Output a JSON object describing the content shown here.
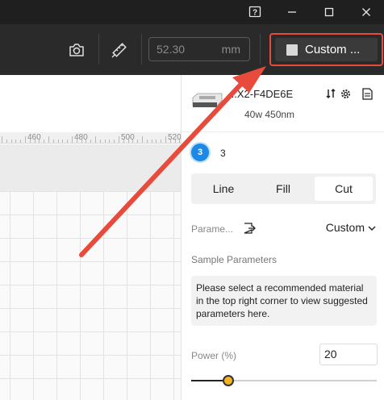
{
  "titlebar": {
    "help_icon": "help-icon",
    "minimize_icon": "minimize-icon",
    "maximize_icon": "maximize-icon",
    "close_icon": "close-icon"
  },
  "toolbar": {
    "camera_icon": "camera-icon",
    "measure_icon": "measure-icon",
    "zoom_value": "52.30",
    "zoom_unit": "mm",
    "custom_label": "Custom ..."
  },
  "ruler": {
    "labels": [
      "460",
      "480",
      "500",
      "520"
    ]
  },
  "device": {
    "name": "...X2-F4DE6E",
    "spec": "40w 450nm"
  },
  "layer": {
    "badge": "3",
    "number": "3"
  },
  "tabs": [
    "Line",
    "Fill",
    "Cut"
  ],
  "parameters": {
    "label": "Parame...",
    "value": "Custom"
  },
  "sample": {
    "title": "Sample Parameters",
    "message": "Please select a recommended material in the top right corner to view suggested parameters here."
  },
  "power": {
    "label": "Power  (%)",
    "value": "20",
    "slider_fraction": 0.2
  },
  "colors": {
    "accent": "#1e88e5",
    "highlight": "#e84b3c",
    "slider_thumb": "#f5b324"
  }
}
